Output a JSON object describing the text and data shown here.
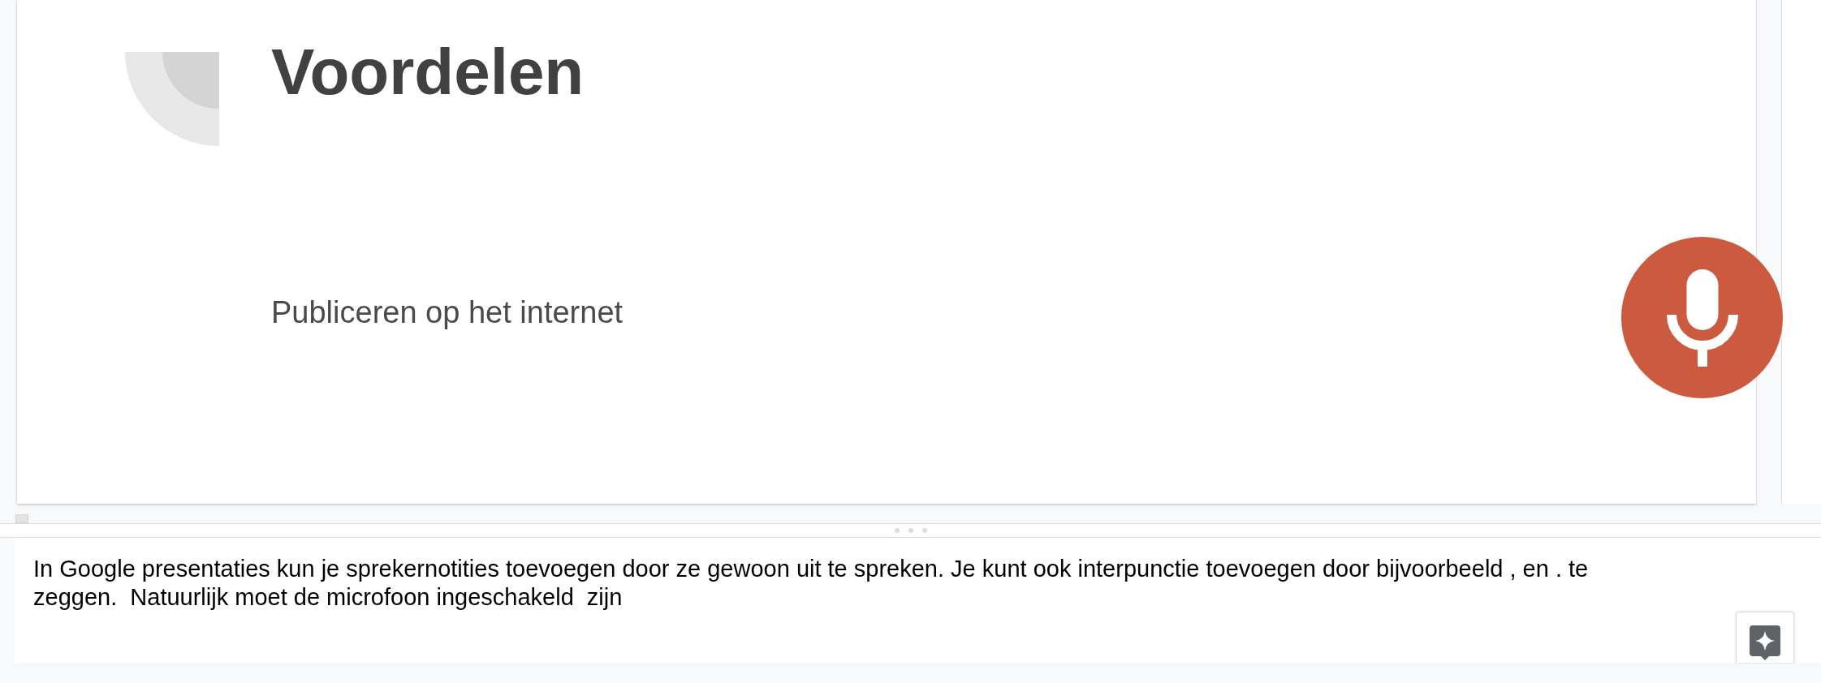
{
  "slide": {
    "title": "Voordelen",
    "body": [
      "Publiceren op het internet"
    ]
  },
  "voice_typing": {
    "listening": true
  },
  "speaker_notes": {
    "text": "In Google presentaties kun je sprekernotities toevoegen door ze gewoon uit te spreken. Je kunt ook interpunctie toevoegen door bijvoorbeeld , en . te zeggen.  Natuurlijk moet de microfoon ingeschakeld  zijn"
  }
}
